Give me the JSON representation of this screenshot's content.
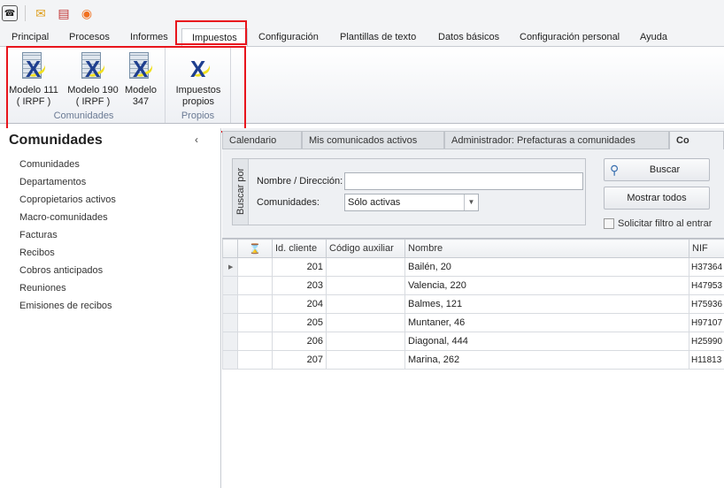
{
  "quick_access": [
    {
      "icon": "phone-icon"
    },
    {
      "icon": "mail-icon"
    },
    {
      "icon": "clipboard-check-icon"
    },
    {
      "icon": "broadcast-icon"
    }
  ],
  "ribbon_tabs": [
    "Principal",
    "Procesos",
    "Informes",
    "Impuestos",
    "Configuración",
    "Plantillas de texto",
    "Datos básicos",
    "Configuración personal",
    "Ayuda"
  ],
  "active_ribbon_tab": "Impuestos",
  "ribbon": {
    "groups": [
      {
        "label": "Comunidades",
        "buttons": [
          {
            "line1": "Modelo 111",
            "line2": "( IRPF )"
          },
          {
            "line1": "Modelo 190",
            "line2": "( IRPF )"
          },
          {
            "line1": "Modelo",
            "line2": "347"
          }
        ]
      },
      {
        "label": "Propios",
        "buttons": [
          {
            "line1": "Impuestos",
            "line2": "propios"
          }
        ]
      }
    ]
  },
  "highlight_color": "#e8141c",
  "left_panel": {
    "title": "Comunidades",
    "items": [
      "Comunidades",
      "Departamentos",
      "Copropietarios activos",
      "Macro-comunidades",
      "Facturas",
      "Recibos",
      "Cobros anticipados",
      "Reuniones",
      "Emisiones de recibos"
    ]
  },
  "doc_tabs": [
    "Calendario",
    "Mis comunicados activos",
    "Administrador: Prefacturas a comunidades",
    "Co"
  ],
  "search": {
    "group_label": "Buscar por",
    "name_label": "Nombre / Dirección:",
    "name_value": "",
    "comm_label": "Comunidades:",
    "comm_value": "Sólo activas",
    "search_button": "Buscar",
    "show_all_button": "Mostrar todos",
    "filter_checkbox": "Solicitar filtro al entrar",
    "filter_checked": false
  },
  "grid": {
    "columns": [
      "",
      "Id. cliente",
      "Código auxiliar",
      "Nombre",
      "NIF"
    ],
    "rows": [
      {
        "id": "201",
        "aux": "",
        "nombre": "Bailén, 20",
        "nif": "H37364"
      },
      {
        "id": "203",
        "aux": "",
        "nombre": "Valencia, 220",
        "nif": "H47953"
      },
      {
        "id": "204",
        "aux": "",
        "nombre": "Balmes, 121",
        "nif": "H75936"
      },
      {
        "id": "205",
        "aux": "",
        "nombre": "Muntaner, 46",
        "nif": "H97107"
      },
      {
        "id": "206",
        "aux": "",
        "nombre": "Diagonal, 444",
        "nif": "H25990"
      },
      {
        "id": "207",
        "aux": "",
        "nombre": "Marina, 262",
        "nif": "H11813"
      }
    ]
  }
}
